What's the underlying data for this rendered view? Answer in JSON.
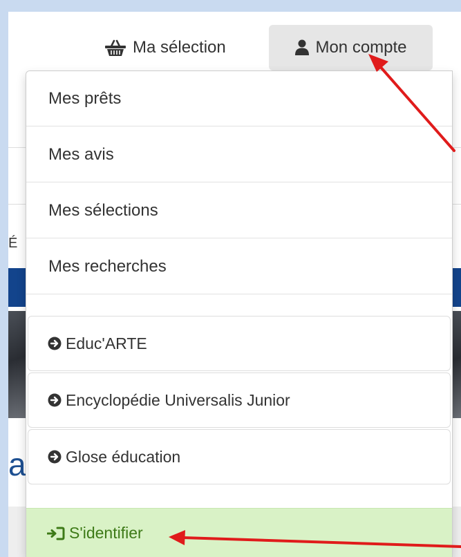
{
  "header": {
    "selection_label": "Ma sélection",
    "account_label": "Mon compte"
  },
  "dropdown": {
    "items": [
      {
        "label": "Mes prêts"
      },
      {
        "label": "Mes avis"
      },
      {
        "label": "Mes sélections"
      },
      {
        "label": "Mes recherches"
      }
    ],
    "resources": [
      {
        "label": "Educ'ARTE"
      },
      {
        "label": "Encyclopédie Universalis Junior"
      },
      {
        "label": "Glose éducation"
      }
    ],
    "login_label": "S'identifier"
  },
  "background": {
    "peek_letter_top": "É",
    "peek_letter_bottom": "a"
  },
  "icons": {
    "selection": "basket-icon",
    "account": "user-icon",
    "resource": "circle-arrow-right-icon",
    "login": "sign-in-icon"
  },
  "colors": {
    "backdrop": "#c9daf0",
    "account_button_bg": "#e6e6e6",
    "login_bg": "#d9f2c6",
    "login_text": "#3d7a17",
    "annotation_arrow": "#e01b1b",
    "banner_blue": "#13448c"
  }
}
